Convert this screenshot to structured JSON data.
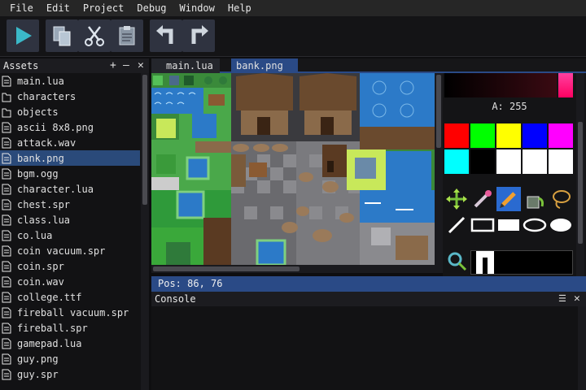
{
  "menu": [
    "File",
    "Edit",
    "Project",
    "Debug",
    "Window",
    "Help"
  ],
  "toolbar": {
    "buttons": [
      {
        "icon": "play-icon"
      },
      {
        "icon": "copy-icon"
      },
      {
        "icon": "cut-icon"
      },
      {
        "icon": "paste-icon"
      },
      {
        "icon": "undo-icon"
      },
      {
        "icon": "redo-icon"
      }
    ]
  },
  "assets": {
    "title": "Assets",
    "items": [
      {
        "label": "main.lua",
        "kind": "file"
      },
      {
        "label": "characters",
        "kind": "folder"
      },
      {
        "label": "objects",
        "kind": "folder"
      },
      {
        "label": "ascii 8x8.png",
        "kind": "file"
      },
      {
        "label": "attack.wav",
        "kind": "file"
      },
      {
        "label": "bank.png",
        "kind": "file"
      },
      {
        "label": "bgm.ogg",
        "kind": "file"
      },
      {
        "label": "character.lua",
        "kind": "file"
      },
      {
        "label": "chest.spr",
        "kind": "file"
      },
      {
        "label": "class.lua",
        "kind": "file"
      },
      {
        "label": "co.lua",
        "kind": "file"
      },
      {
        "label": "coin vacuum.spr",
        "kind": "file"
      },
      {
        "label": "coin.spr",
        "kind": "file"
      },
      {
        "label": "coin.wav",
        "kind": "file"
      },
      {
        "label": "college.ttf",
        "kind": "file"
      },
      {
        "label": "fireball vacuum.spr",
        "kind": "file"
      },
      {
        "label": "fireball.spr",
        "kind": "file"
      },
      {
        "label": "gamepad.lua",
        "kind": "file"
      },
      {
        "label": "guy.png",
        "kind": "file"
      },
      {
        "label": "guy.spr",
        "kind": "file"
      }
    ],
    "selected": "bank.png"
  },
  "tabs": [
    {
      "label": "main.lua",
      "active": false
    },
    {
      "label": "bank.png",
      "active": true
    }
  ],
  "editor": {
    "status": "Pos: 86, 76"
  },
  "palette": {
    "alpha_label": "A: 255",
    "swatches_row1": [
      "#ff0000",
      "#00ff00",
      "#ffff00",
      "#0000ff",
      "#ff00ff"
    ],
    "swatches_row2": [
      "#00ffff",
      "#000000",
      "#ffffff",
      "#ffffff",
      "#ffffff"
    ],
    "tools": [
      "move-icon",
      "eyedropper-icon",
      "pencil-icon",
      "bucket-icon",
      "lasso-icon",
      "line-icon",
      "rect-outline-icon",
      "rect-fill-icon",
      "ellipse-outline-icon",
      "ellipse-fill-icon"
    ]
  },
  "console": {
    "title": "Console"
  },
  "colors": {
    "accent": "#2a4a86",
    "selected_row": "#2a4a7a",
    "button_bg": "#2f3340"
  }
}
